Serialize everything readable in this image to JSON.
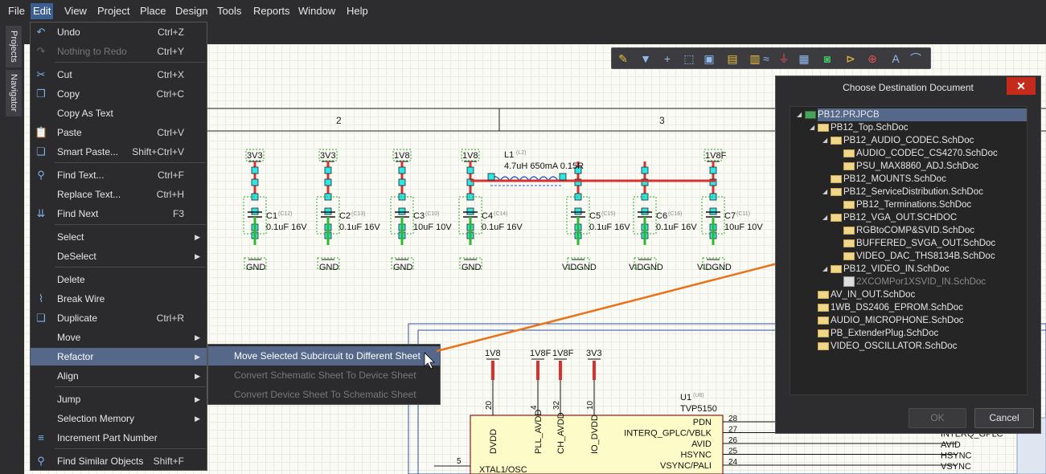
{
  "menubar": [
    "File",
    "Edit",
    "View",
    "Project",
    "Place",
    "Design",
    "Tools",
    "Reports",
    "Window",
    "Help"
  ],
  "side_tabs": [
    "Projects",
    "Navigator"
  ],
  "edit_menu": [
    {
      "label": "Undo",
      "shortcut": "Ctrl+Z",
      "icon": "undo-icon"
    },
    {
      "label": "Nothing to Redo",
      "shortcut": "Ctrl+Y",
      "icon": "redo-icon",
      "disabled": true
    },
    {
      "label": "Cut",
      "shortcut": "Ctrl+X",
      "icon": "cut-icon"
    },
    {
      "label": "Copy",
      "shortcut": "Ctrl+C",
      "icon": "copy-icon"
    },
    {
      "label": "Copy As Text",
      "shortcut": "",
      "icon": ""
    },
    {
      "label": "Paste",
      "shortcut": "Ctrl+V",
      "icon": "paste-icon"
    },
    {
      "label": "Smart Paste...",
      "shortcut": "Shift+Ctrl+V",
      "icon": "smart-paste-icon"
    },
    {
      "label": "Find Text...",
      "shortcut": "Ctrl+F",
      "icon": "find-text-icon"
    },
    {
      "label": "Replace Text...",
      "shortcut": "Ctrl+H",
      "icon": ""
    },
    {
      "label": "Find Next",
      "shortcut": "F3",
      "icon": "find-next-icon"
    },
    {
      "label": "Select",
      "shortcut": "",
      "submenu": true
    },
    {
      "label": "DeSelect",
      "shortcut": "",
      "submenu": true
    },
    {
      "label": "Delete",
      "shortcut": "",
      "icon": ""
    },
    {
      "label": "Break Wire",
      "shortcut": "",
      "icon": "break-wire-icon"
    },
    {
      "label": "Duplicate",
      "shortcut": "Ctrl+R",
      "icon": "duplicate-icon"
    },
    {
      "label": "Move",
      "shortcut": "",
      "submenu": true
    },
    {
      "label": "Refactor",
      "shortcut": "",
      "submenu": true,
      "highlight": true
    },
    {
      "label": "Align",
      "shortcut": "",
      "submenu": true
    },
    {
      "label": "Jump",
      "shortcut": "",
      "submenu": true
    },
    {
      "label": "Selection Memory",
      "shortcut": "",
      "submenu": true
    },
    {
      "label": "Increment Part Number",
      "shortcut": "",
      "icon": "increment-icon"
    },
    {
      "label": "Find Similar Objects",
      "shortcut": "Shift+F",
      "icon": "find-similar-icon"
    }
  ],
  "refactor_submenu": [
    {
      "label": "Move Selected Subcircuit to Different Sheet",
      "highlight": true
    },
    {
      "label": "Convert Schematic Sheet To Device Sheet",
      "disabled": true
    },
    {
      "label": "Convert Device Sheet To Schematic Sheet",
      "disabled": true
    }
  ],
  "dialog": {
    "title": "Choose Destination Document",
    "close": "✕",
    "ok": "OK",
    "cancel": "Cancel",
    "tree": [
      {
        "label": "PB12.PRJPCB",
        "level": 0,
        "expanded": true,
        "type": "project",
        "selected": true
      },
      {
        "label": "PB12_Top.SchDoc",
        "level": 1,
        "expanded": true,
        "type": "sheet"
      },
      {
        "label": "PB12_AUDIO_CODEC.SchDoc",
        "level": 2,
        "expanded": true,
        "type": "sheet"
      },
      {
        "label": "AUDIO_CODEC_CS4270.SchDoc",
        "level": 3,
        "type": "sheet"
      },
      {
        "label": "PSU_MAX8860_ADJ.SchDoc",
        "level": 3,
        "type": "sheet"
      },
      {
        "label": "PB12_MOUNTS.SchDoc",
        "level": 2,
        "type": "sheet"
      },
      {
        "label": "PB12_ServiceDistribution.SchDoc",
        "level": 2,
        "expanded": true,
        "type": "sheet"
      },
      {
        "label": "PB12_Terminations.SchDoc",
        "level": 3,
        "type": "sheet"
      },
      {
        "label": "PB12_VGA_OUT.SCHDOC",
        "level": 2,
        "expanded": true,
        "type": "sheet"
      },
      {
        "label": "RGBtoCOMP&SVID.SchDoc",
        "level": 3,
        "type": "sheet"
      },
      {
        "label": "BUFFERED_SVGA_OUT.SchDoc",
        "level": 3,
        "type": "sheet"
      },
      {
        "label": "VIDEO_DAC_THS8134B.SchDoc",
        "level": 3,
        "type": "sheet"
      },
      {
        "label": "PB12_VIDEO_IN.SchDoc",
        "level": 2,
        "expanded": true,
        "type": "sheet"
      },
      {
        "label": "2XCOMPor1XSVID_IN.SchDoc",
        "level": 3,
        "type": "doc",
        "grey": true
      },
      {
        "label": "AV_IN_OUT.SchDoc",
        "level": 1,
        "type": "sheet"
      },
      {
        "label": "1WB_DS2406_EPROM.SchDoc",
        "level": 1,
        "type": "sheet"
      },
      {
        "label": "AUDIO_MICROPHONE.SchDoc",
        "level": 1,
        "type": "sheet"
      },
      {
        "label": "PB_ExtenderPlug.SchDoc",
        "level": 1,
        "type": "sheet"
      },
      {
        "label": "VIDEO_OSCILLATOR.SchDoc",
        "level": 1,
        "type": "sheet"
      }
    ]
  },
  "schematic": {
    "zones": [
      "2",
      "3"
    ],
    "caps": [
      {
        "net": "3V3",
        "ref": "C1",
        "des": "(C12)",
        "val": "0.1uF 16V",
        "gnd": "GND"
      },
      {
        "net": "3V3",
        "ref": "C2",
        "des": "(C13)",
        "val": "0.1uF 16V",
        "gnd": "GND"
      },
      {
        "net": "1V8",
        "ref": "C3",
        "des": "(C10)",
        "val": "10uF 10V",
        "gnd": "GND"
      },
      {
        "net": "1V8",
        "ref": "C4",
        "des": "(C14)",
        "val": "0.1uF 16V",
        "gnd": "GND"
      },
      {
        "net": "",
        "ref": "C5",
        "des": "(C15)",
        "val": "0.1uF 16V",
        "gnd": "VIDGND"
      },
      {
        "net": "",
        "ref": "C6",
        "des": "(C16)",
        "val": "0.1uF 16V",
        "gnd": "VIDGND"
      },
      {
        "net": "1V8F",
        "ref": "C7",
        "des": "(C11)",
        "val": "10uF 10V",
        "gnd": "VIDGND"
      }
    ],
    "inductor": {
      "ref": "L1",
      "des": "(L2)",
      "val": "4.7uH 650mA 0.15R"
    },
    "chip": {
      "ref": "U1",
      "des": "(U8)",
      "part": "TVP5150",
      "top_nets": [
        "1V8",
        "1V8F",
        "1V8F",
        "3V3"
      ],
      "top_pins": [
        "20",
        "4",
        "32",
        "10"
      ],
      "vert_pins": [
        "DVDD",
        "PLL_AVDD",
        "CH_AVDD",
        "IO_DVDD"
      ],
      "right_pins": [
        {
          "name": "PDN",
          "num": "28",
          "net": ""
        },
        {
          "name": "INTERQ_GPLC/VBLK",
          "num": "27",
          "net": "INTERQ_GPLC"
        },
        {
          "name": "AVID",
          "num": "26",
          "net": "AVID"
        },
        {
          "name": "HSYNC",
          "num": "25",
          "net": "HSYNC"
        },
        {
          "name": "VSYNC/PALI",
          "num": "24",
          "net": "VSYNC"
        }
      ],
      "left_pin": {
        "name": "XTAL1/OSC",
        "num": "5"
      }
    }
  }
}
